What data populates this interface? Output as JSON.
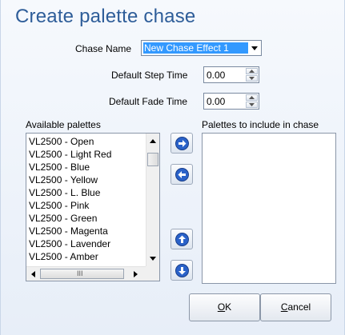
{
  "dialog": {
    "title": "Create palette chase",
    "chase_name_label": "Chase Name",
    "chase_name_value": "New Chase Effect 1",
    "step_time_label": "Default Step Time",
    "step_time_value": "0.00",
    "fade_time_label": "Default Fade Time",
    "fade_time_value": "0.00",
    "available_label": "Available palettes",
    "include_label": "Palettes to include in chase",
    "available_items": [
      "VL2500  - Open",
      "VL2500  - Light Red",
      "VL2500  - Blue",
      "VL2500  - Yellow",
      "VL2500  - L. Blue",
      "VL2500  - Pink",
      "VL2500  - Green",
      "VL2500  - Magenta",
      "VL2500  - Lavender",
      "VL2500  - Amber"
    ],
    "ok_mnemonic": "O",
    "ok_rest": "K",
    "cancel_mnemonic": "C",
    "cancel_rest": "ancel",
    "hscroll_grip": "III"
  },
  "colors": {
    "title": "#2e5d99",
    "selection": "#3399ff",
    "nav_button_blue": "#2a62c9"
  }
}
